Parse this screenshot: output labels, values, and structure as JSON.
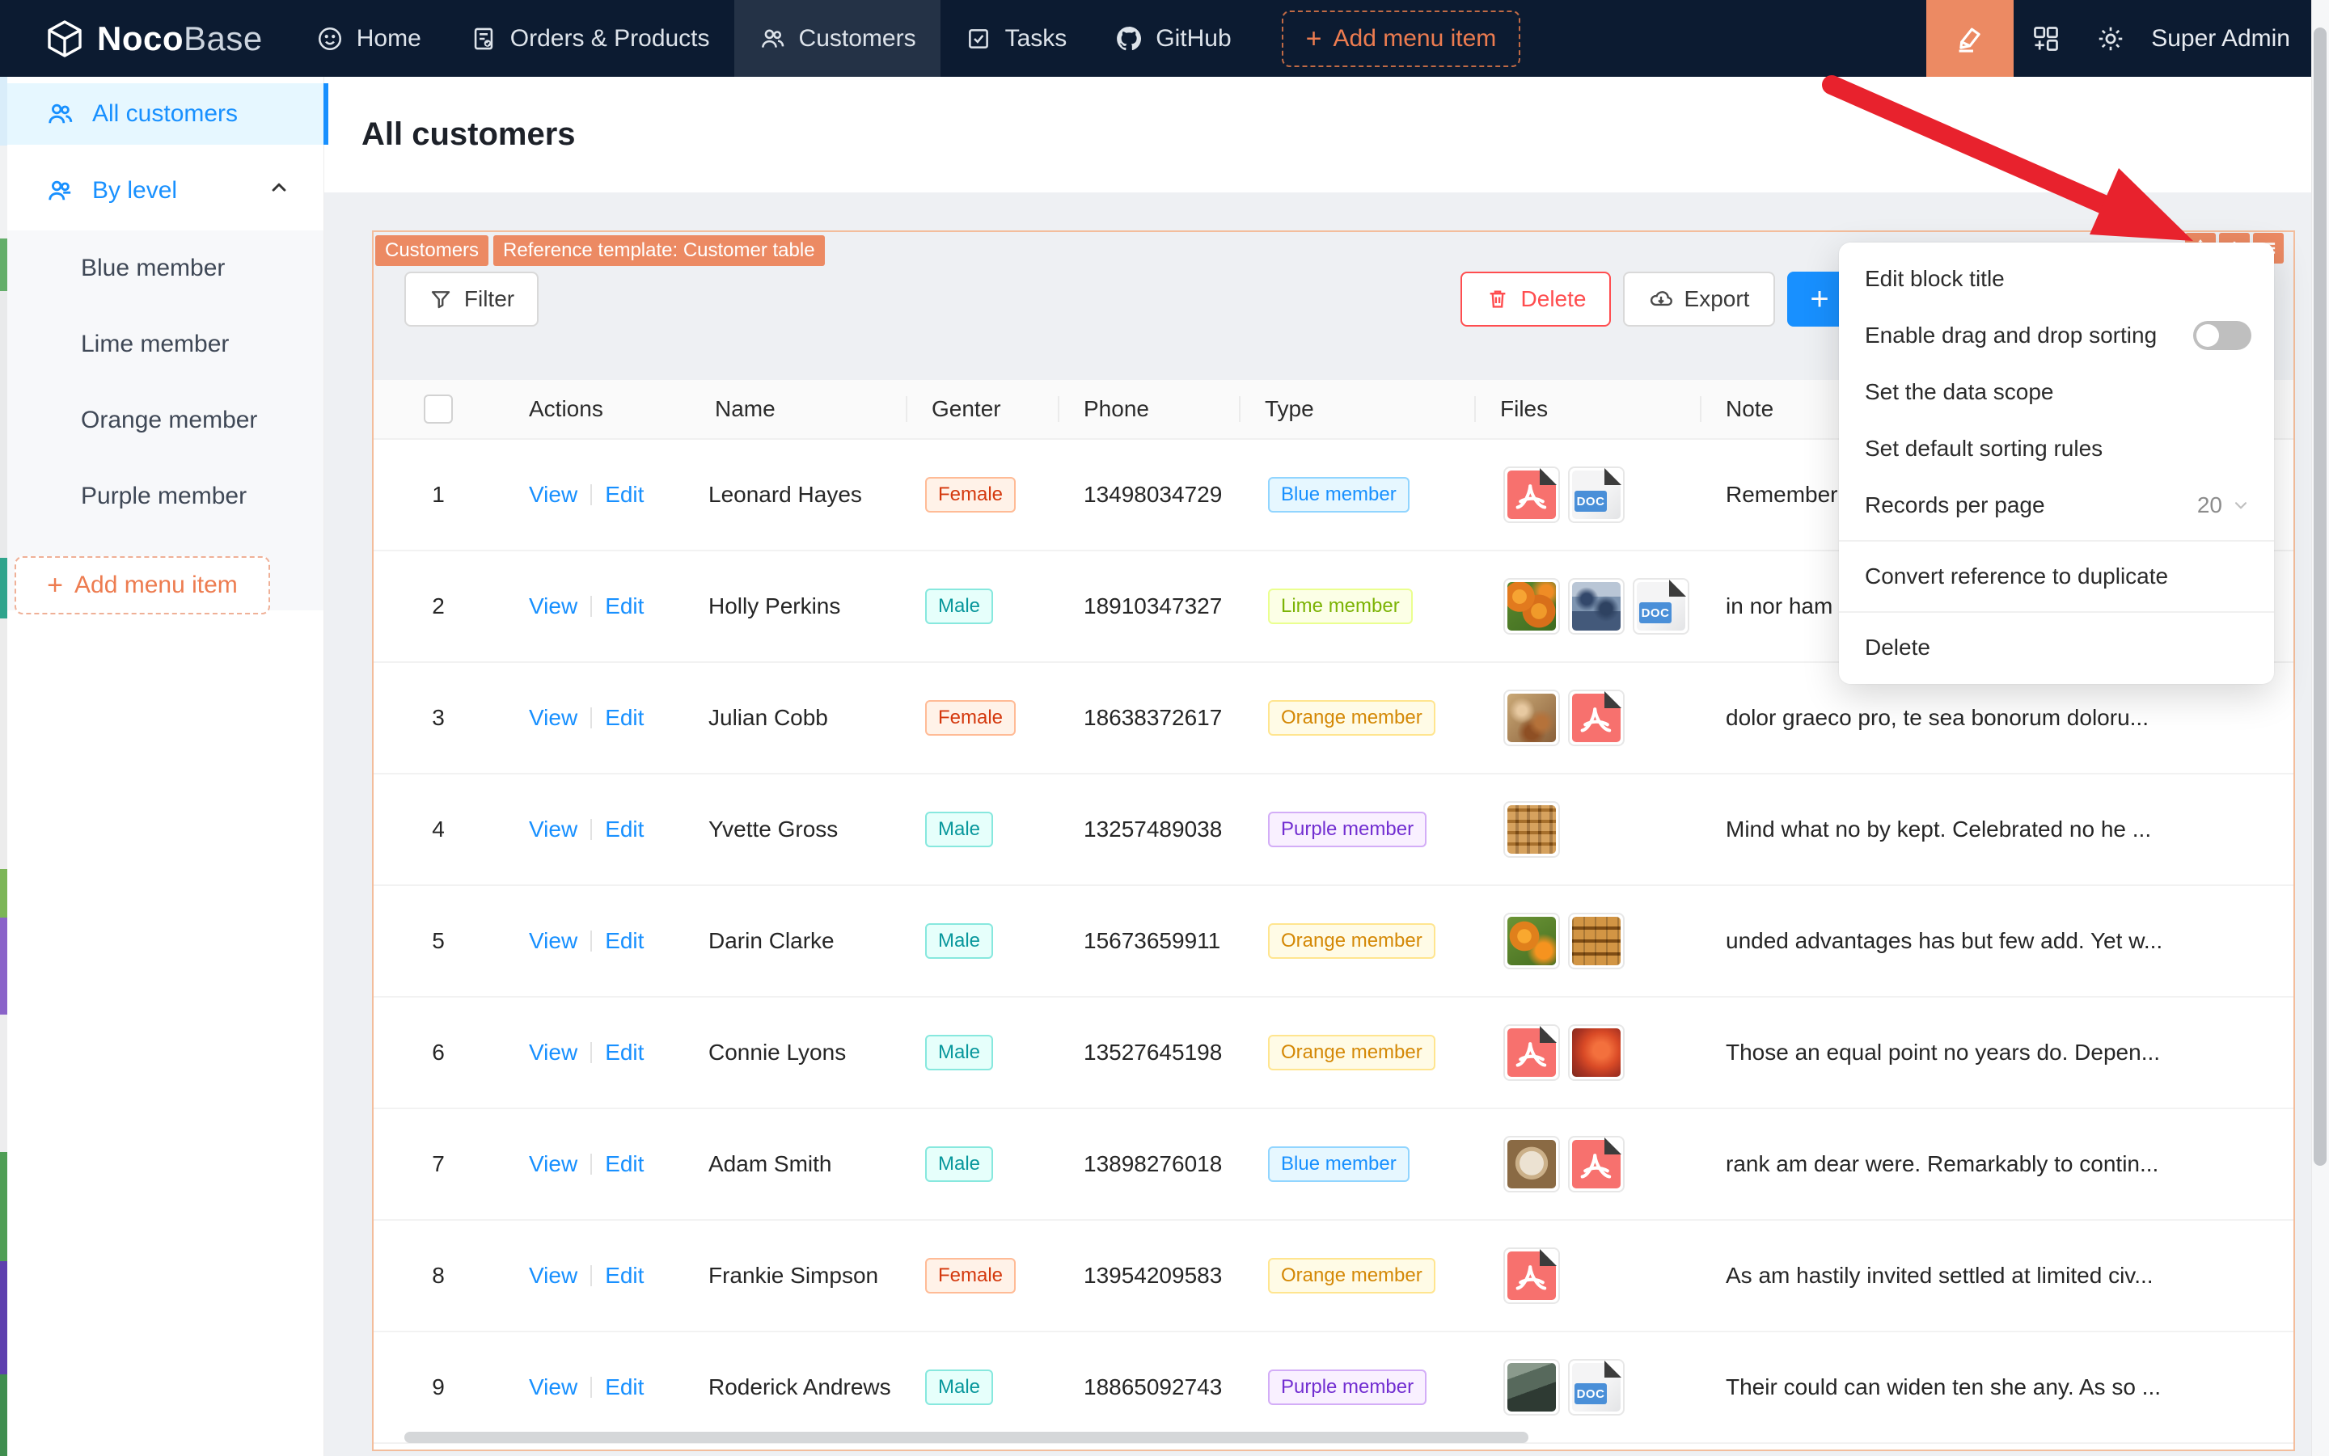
{
  "navbar": {
    "logo": {
      "noco": "Noco",
      "base": "Base"
    },
    "items": [
      {
        "label": "Home",
        "icon": "smiley-icon",
        "active": false
      },
      {
        "label": "Orders & Products",
        "icon": "document-icon",
        "active": false
      },
      {
        "label": "Customers",
        "icon": "team-icon",
        "active": true
      },
      {
        "label": "Tasks",
        "icon": "check-square-icon",
        "active": false
      },
      {
        "label": "GitHub",
        "icon": "github-icon",
        "active": false
      }
    ],
    "add_item_label": "Add menu item",
    "user": "Super Admin"
  },
  "sidebar": {
    "items": [
      {
        "label": "All customers",
        "active": true
      },
      {
        "label": "By level",
        "expanded": true
      }
    ],
    "sub_items": [
      "Blue member",
      "Lime member",
      "Orange member",
      "Purple member"
    ],
    "add_item_label": "Add menu item"
  },
  "page": {
    "title": "All customers"
  },
  "block": {
    "tags": [
      "Customers",
      "Reference template: Customer table"
    ],
    "toolbar": {
      "filter": "Filter",
      "delete": "Delete",
      "export": "Export",
      "add": "+"
    }
  },
  "menu": {
    "items": [
      "Edit block title",
      "Enable drag and drop sorting",
      "Set the data scope",
      "Set default sorting rules",
      "Records per page",
      "Convert reference to duplicate",
      "Delete"
    ],
    "records_per_page_value": "20",
    "drag_sorting_enabled": false
  },
  "table": {
    "columns": [
      "",
      "Actions",
      "Name",
      "Genter",
      "Phone",
      "Type",
      "Files",
      "Note"
    ],
    "action_labels": {
      "view": "View",
      "edit": "Edit"
    },
    "file_labels": {
      "doc": "DOC"
    },
    "rows": [
      {
        "index": "1",
        "name": "Leonard Hayes",
        "gender": {
          "label": "Female",
          "color": "volcano"
        },
        "phone": "13498034729",
        "type": {
          "label": "Blue member",
          "color": "blue"
        },
        "files": [
          {
            "kind": "pdf"
          },
          {
            "kind": "doc"
          }
        ],
        "note": "Remember"
      },
      {
        "index": "2",
        "name": "Holly Perkins",
        "gender": {
          "label": "Male",
          "color": "cyan"
        },
        "phone": "18910347327",
        "type": {
          "label": "Lime member",
          "color": "lime"
        },
        "files": [
          {
            "kind": "img",
            "variant": "oranges"
          },
          {
            "kind": "img",
            "variant": "people"
          },
          {
            "kind": "doc"
          }
        ],
        "note": "in nor ham"
      },
      {
        "index": "3",
        "name": "Julian Cobb",
        "gender": {
          "label": "Female",
          "color": "volcano"
        },
        "phone": "18638372617",
        "type": {
          "label": "Orange member",
          "color": "gold"
        },
        "files": [
          {
            "kind": "img",
            "variant": "food"
          },
          {
            "kind": "pdf"
          }
        ],
        "note": "dolor graeco pro, te sea bonorum doloru..."
      },
      {
        "index": "4",
        "name": "Yvette Gross",
        "gender": {
          "label": "Male",
          "color": "cyan"
        },
        "phone": "13257489038",
        "type": {
          "label": "Purple member",
          "color": "purple"
        },
        "files": [
          {
            "kind": "img",
            "variant": "pretzel"
          }
        ],
        "note": "Mind what no by kept. Celebrated no he ..."
      },
      {
        "index": "5",
        "name": "Darin Clarke",
        "gender": {
          "label": "Male",
          "color": "cyan"
        },
        "phone": "15673659911",
        "type": {
          "label": "Orange member",
          "color": "gold"
        },
        "files": [
          {
            "kind": "img",
            "variant": "oranges2"
          },
          {
            "kind": "img",
            "variant": "grid"
          }
        ],
        "note": "unded advantages has but few add. Yet w..."
      },
      {
        "index": "6",
        "name": "Connie Lyons",
        "gender": {
          "label": "Male",
          "color": "cyan"
        },
        "phone": "13527645198",
        "type": {
          "label": "Orange member",
          "color": "gold"
        },
        "files": [
          {
            "kind": "pdf"
          },
          {
            "kind": "img",
            "variant": "redfruit"
          }
        ],
        "note": "Those an equal point no years do. Depen..."
      },
      {
        "index": "7",
        "name": "Adam Smith",
        "gender": {
          "label": "Male",
          "color": "cyan"
        },
        "phone": "13898276018",
        "type": {
          "label": "Blue member",
          "color": "blue"
        },
        "files": [
          {
            "kind": "img",
            "variant": "coffee"
          },
          {
            "kind": "pdf"
          }
        ],
        "note": "rank am dear were. Remarkably to contin..."
      },
      {
        "index": "8",
        "name": "Frankie Simpson",
        "gender": {
          "label": "Female",
          "color": "volcano"
        },
        "phone": "13954209583",
        "type": {
          "label": "Orange member",
          "color": "gold"
        },
        "files": [
          {
            "kind": "pdf"
          }
        ],
        "note": "As am hastily invited settled at limited civ..."
      },
      {
        "index": "9",
        "name": "Roderick Andrews",
        "gender": {
          "label": "Male",
          "color": "cyan"
        },
        "phone": "18865092743",
        "type": {
          "label": "Purple member",
          "color": "purple"
        },
        "files": [
          {
            "kind": "img",
            "variant": "darkscene"
          },
          {
            "kind": "doc"
          }
        ],
        "note": "Their could can widen ten she any. As so ..."
      }
    ]
  },
  "tag_colors": {
    "volcano": {
      "bg": "#fff2e8",
      "border": "#ffbb96",
      "text": "#d4380d"
    },
    "cyan": {
      "bg": "#e6fffb",
      "border": "#87e8de",
      "text": "#08979c"
    },
    "blue": {
      "bg": "#e6f7ff",
      "border": "#91d5ff",
      "text": "#1890ff"
    },
    "lime": {
      "bg": "#fcffe6",
      "border": "#eaff8f",
      "text": "#7cb305"
    },
    "gold": {
      "bg": "#fffbe6",
      "border": "#ffe58f",
      "text": "#d48806"
    },
    "purple": {
      "bg": "#f9f0ff",
      "border": "#d3adf7",
      "text": "#722ed1"
    }
  },
  "accent": {
    "orange": "#ec8a63",
    "link_blue": "#1890ff",
    "navbar_bg": "#0c1b31",
    "arrow_red": "#e8222d"
  }
}
